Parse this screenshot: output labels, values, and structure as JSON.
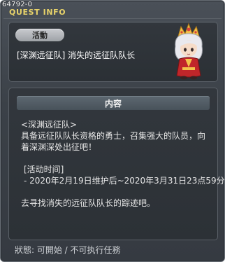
{
  "window": {
    "quest_id": "64792-0",
    "title": "QUEST INFO"
  },
  "quest": {
    "badge": "活動",
    "name": "[深渊远征队] 消失的远征队队长"
  },
  "content": {
    "header": "内容",
    "lines": [
      "<深渊远征队>",
      "具备远征队队长资格的勇士，召集强大的队员，向",
      "着深渊深处出征吧！",
      "",
      " [活动时间]",
      " - 2020年2月19日维护后~2020年3月31日23点59分",
      "",
      "去寻找消失的远征队队长的踪迹吧。"
    ]
  },
  "status": {
    "text": "狀態: 可開始 / 不可执行任務"
  },
  "colors": {
    "title": "#e8d36a",
    "panel_bg": "#2e3338",
    "text": "#e6e6e6"
  },
  "icons": {
    "avatar": "npc-character-portrait"
  }
}
